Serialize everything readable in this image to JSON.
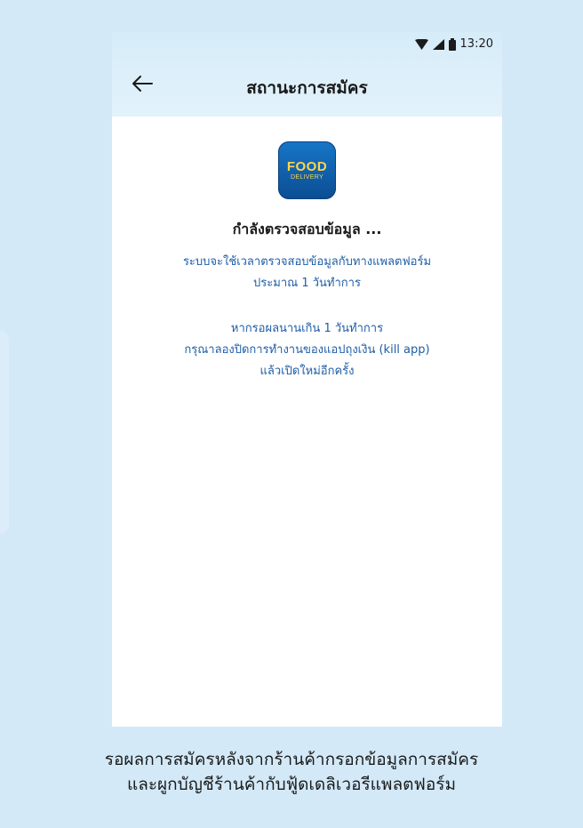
{
  "status_bar": {
    "time": "13:20",
    "icons": [
      "wifi-icon",
      "cell-signal-icon",
      "battery-icon"
    ]
  },
  "app_bar": {
    "back_icon": "arrow-left-icon",
    "title": "สถานะการสมัคร"
  },
  "content": {
    "logo": {
      "line1": "FOOD",
      "line2": "DELIVERY"
    },
    "heading": "กำลังตรวจสอบข้อมูล ...",
    "info1": {
      "line1": "ระบบจะใช้เวลาตรวจสอบข้อมูลกับทางแพลตฟอร์ม",
      "line2": "ประมาณ 1 วันทำการ"
    },
    "info2": {
      "line1": "หากรอผลนานเกิน 1 วันทำการ",
      "line2": "กรุณาลองปิดการทำงานของแอปถุงเงิน (kill app)",
      "line3": "แล้วเปิดใหม่อีกครั้ง"
    }
  },
  "caption": {
    "line1": "รอผลการสมัครหลังจากร้านค้ากรอกข้อมูลการสมัคร",
    "line2": "และผูกบัญชีร้านค้ากับฟู้ดเดลิเวอรีแพลตฟอร์ม"
  },
  "colors": {
    "background": "#d3e9f8",
    "accent_text": "#1e5ea8",
    "logo_blue": "#1570c0",
    "logo_yellow": "#ffd54a"
  }
}
